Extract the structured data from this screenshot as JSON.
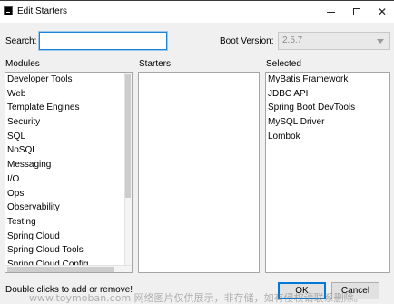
{
  "window": {
    "title": "Edit Starters",
    "min_icon": "minimize-icon",
    "max_icon": "maximize-icon",
    "close_glyph": "✕"
  },
  "search": {
    "label": "Search:",
    "value": ""
  },
  "boot": {
    "label": "Boot Version:",
    "value": "2.5.7"
  },
  "columns": {
    "modules": "Modules",
    "starters": "Starters",
    "selected": "Selected"
  },
  "modules": [
    "Developer Tools",
    "Web",
    "Template Engines",
    "Security",
    "SQL",
    "NoSQL",
    "Messaging",
    "I/O",
    "Ops",
    "Observability",
    "Testing",
    "Spring Cloud",
    "Spring Cloud Tools",
    "Spring Cloud Config"
  ],
  "selected": [
    "MyBatis Framework",
    "JDBC API",
    "Spring Boot DevTools",
    "MySQL Driver",
    "Lombok"
  ],
  "footer": {
    "hint": "Double clicks to add or remove!",
    "ok": "OK",
    "cancel": "Cancel",
    "watermark": "www.toymoban.com 网络图片仅供展示，非存储，如有侵权请联系删除。"
  },
  "colors": {
    "focus": "#1c83d8",
    "ok_border": "#0078d7"
  }
}
